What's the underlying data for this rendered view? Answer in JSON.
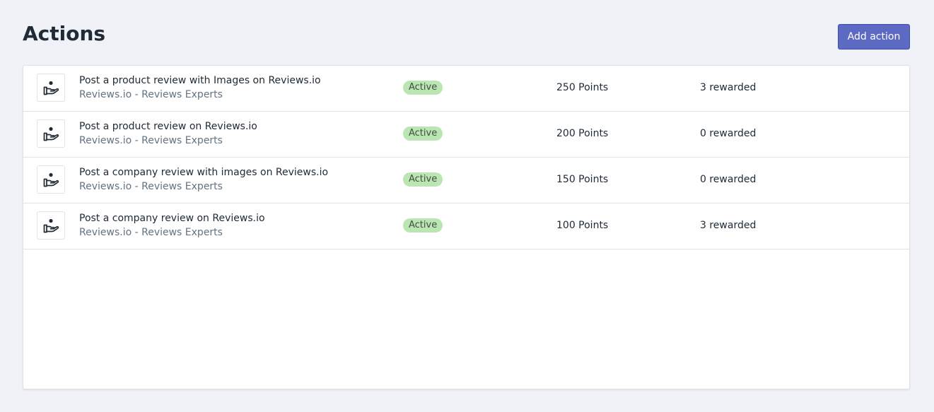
{
  "header": {
    "title": "Actions",
    "add_action_label": "Add action"
  },
  "colors": {
    "background": "#f0f2f7",
    "primary_button": "#5c6ac4",
    "badge_active_bg": "#bbe5b3",
    "badge_active_text": "#414f3e",
    "subtitle_text": "#637381"
  },
  "actions": [
    {
      "icon": "hand-reward-icon",
      "title": "Post a product review with Images on Reviews.io",
      "subtitle": "Reviews.io - Reviews Experts",
      "status": "Active",
      "points": "250 Points",
      "rewarded": "3 rewarded"
    },
    {
      "icon": "hand-reward-icon",
      "title": "Post a product review on Reviews.io",
      "subtitle": "Reviews.io - Reviews Experts",
      "status": "Active",
      "points": "200 Points",
      "rewarded": "0 rewarded"
    },
    {
      "icon": "hand-reward-icon",
      "title": "Post a company review with images on Reviews.io",
      "subtitle": "Reviews.io - Reviews Experts",
      "status": "Active",
      "points": "150 Points",
      "rewarded": "0 rewarded"
    },
    {
      "icon": "hand-reward-icon",
      "title": "Post a company review on Reviews.io",
      "subtitle": "Reviews.io - Reviews Experts",
      "status": "Active",
      "points": "100 Points",
      "rewarded": "3 rewarded"
    }
  ]
}
